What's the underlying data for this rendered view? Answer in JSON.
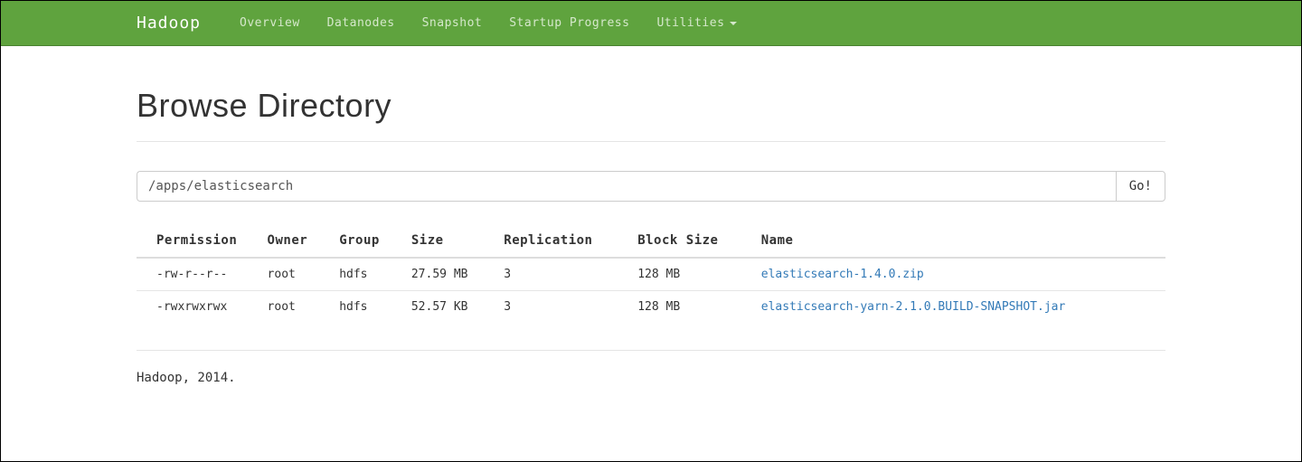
{
  "navbar": {
    "brand": "Hadoop",
    "items": [
      {
        "label": "Overview"
      },
      {
        "label": "Datanodes"
      },
      {
        "label": "Snapshot"
      },
      {
        "label": "Startup Progress"
      },
      {
        "label": "Utilities"
      }
    ]
  },
  "title": "Browse Directory",
  "path": {
    "value": "/apps/elasticsearch",
    "go_label": "Go!"
  },
  "table": {
    "headers": {
      "permission": "Permission",
      "owner": "Owner",
      "group": "Group",
      "size": "Size",
      "replication": "Replication",
      "block_size": "Block Size",
      "name": "Name"
    },
    "rows": [
      {
        "permission": "-rw-r--r--",
        "owner": "root",
        "group": "hdfs",
        "size": "27.59 MB",
        "replication": "3",
        "block_size": "128 MB",
        "name": "elasticsearch-1.4.0.zip"
      },
      {
        "permission": "-rwxrwxrwx",
        "owner": "root",
        "group": "hdfs",
        "size": "52.57 KB",
        "replication": "3",
        "block_size": "128 MB",
        "name": "elasticsearch-yarn-2.1.0.BUILD-SNAPSHOT.jar"
      }
    ]
  },
  "footer": "Hadoop, 2014."
}
